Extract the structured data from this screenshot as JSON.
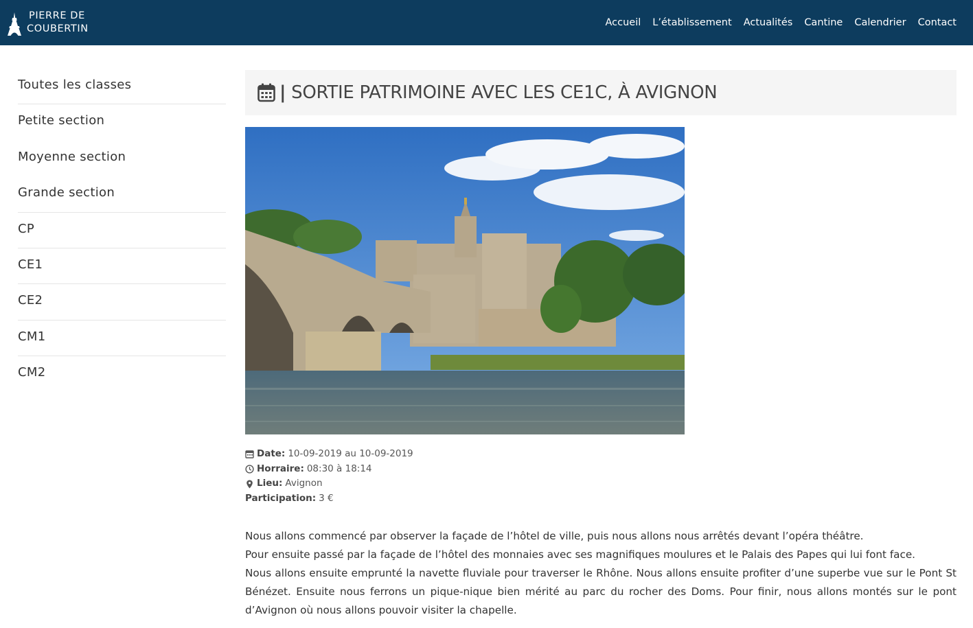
{
  "header": {
    "logo_line1": "PIERRE DE",
    "logo_line2": "COUBERTIN",
    "nav": [
      "Accueil",
      "L’établissement",
      "Actualités",
      "Cantine",
      "Calendrier",
      "Contact"
    ]
  },
  "sidebar": {
    "items": [
      "Toutes les classes",
      "Petite section",
      "Moyenne section",
      "Grande section",
      "CP",
      "CE1",
      "CE2",
      "CM1",
      "CM2"
    ]
  },
  "event": {
    "title_prefix": "|",
    "title": "SORTIE PATRIMOINE AVEC LES CE1C, À AVIGNON",
    "date_label": "Date:",
    "date_value": "10-09-2019 au 10-09-2019",
    "time_label": "Horraire:",
    "time_value": "08:30 à 18:14",
    "place_label": "Lieu:",
    "place_value": "Avignon",
    "price_label": "Participation:",
    "price_value": "3 €",
    "paragraphs": [
      "Nous allons commencé par observer la façade de l’hôtel de ville, puis nous allons nous arrêtés devant l’opéra théâtre.",
      "Pour ensuite passé par la façade de l’hôtel des monnaies avec ses magnifiques moulures et le Palais des Papes qui lui font face.",
      "Nous allons ensuite emprunté la navette fluviale pour traverser le Rhône. Nous allons ensuite profiter d’une superbe vue sur le Pont St Bénézet. Ensuite nous ferrons un pique-nique bien mérité au parc du rocher des Doms. Pour finir, nous allons montés sur le pont d’Avignon où nous allons pouvoir visiter la chapelle."
    ]
  },
  "colors": {
    "header_bg": "#0d3c5e",
    "title_bg": "#f5f5f5"
  },
  "icons": {
    "logo": "eiffel-tower-icon",
    "title": "calendar-icon",
    "date": "calendar-icon",
    "time": "clock-icon",
    "place": "map-marker-icon"
  }
}
